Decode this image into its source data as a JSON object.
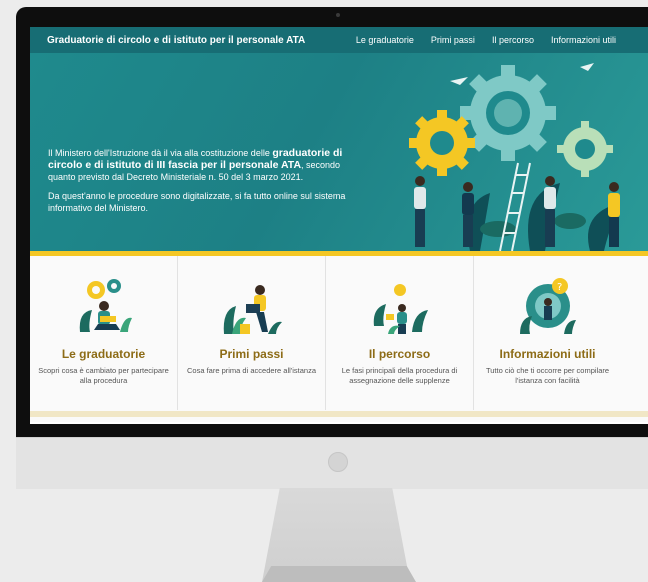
{
  "nav": {
    "title": "Graduatorie di circolo e di istituto per il personale ATA",
    "links": [
      "Le graduatorie",
      "Primi passi",
      "Il percorso",
      "Informazioni utili"
    ]
  },
  "hero": {
    "p1_pre": "Il Ministero dell'Istruzione dà il via alla costituzione delle ",
    "p1_bold": "graduatorie di circolo e di istituto di III fascia per il personale ATA",
    "p1_post": ", secondo quanto previsto dal Decreto Ministeriale n. 50 del 3 marzo 2021.",
    "p2": "Da quest'anno le procedure sono digitalizzate, si fa tutto online sul sistema informativo del Ministero."
  },
  "cards": [
    {
      "title": "Le graduatorie",
      "desc": "Scopri cosa è cambiato per partecipare alla procedura",
      "icon": "person-reading-gears-icon"
    },
    {
      "title": "Primi passi",
      "desc": "Cosa fare prima di accedere all'istanza",
      "icon": "person-laptop-icon"
    },
    {
      "title": "Il percorso",
      "desc": "Le fasi principali della procedura di assegnazione delle supplenze",
      "icon": "person-watering-plants-icon"
    },
    {
      "title": "Informazioni utili",
      "desc": "Tutto ciò che ti occorre per compilare l'istanza con facilità",
      "icon": "person-question-gear-icon"
    }
  ],
  "colors": {
    "nav": "#176d74",
    "hero": "#1f8a8d",
    "accent": "#f4c724",
    "card_title": "#8d6c17"
  }
}
